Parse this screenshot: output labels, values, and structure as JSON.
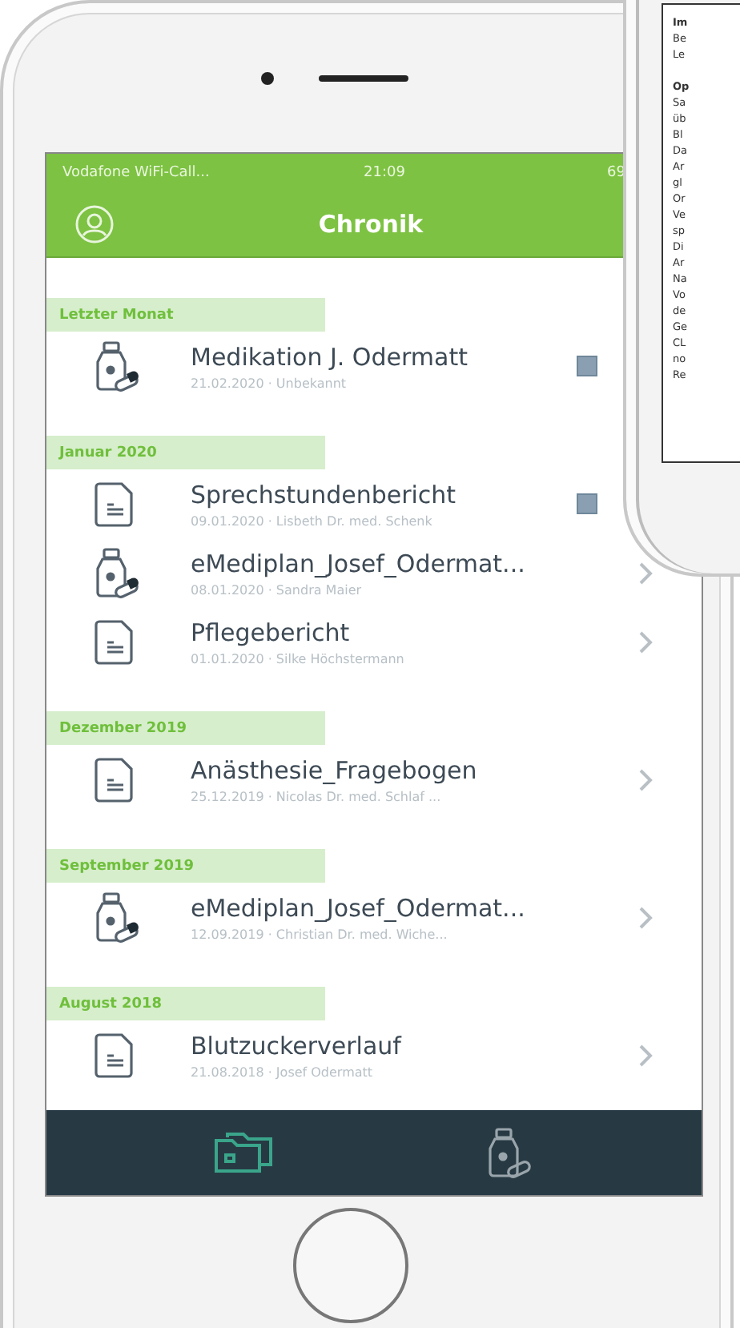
{
  "status_bar": {
    "carrier": "Vodafone WiFi-Call...",
    "time": "21:09",
    "battery": "69"
  },
  "header": {
    "title": "Chronik"
  },
  "sections": [
    {
      "label": "Letzter Monat",
      "items": [
        {
          "kind": "medication",
          "title": "Medikation J. Odermatt",
          "subtitle": "21.02.2020 · Unbekannt",
          "has_badge": true
        }
      ]
    },
    {
      "label": "Januar 2020",
      "items": [
        {
          "kind": "document",
          "title": "Sprechstundenbericht",
          "subtitle": "09.01.2020 · Lisbeth Dr. med. Schenk",
          "has_badge": true
        },
        {
          "kind": "medication",
          "title": "eMediplan_Josef_Odermat...",
          "subtitle": "08.01.2020 · Sandra Maier",
          "has_badge": false
        },
        {
          "kind": "document",
          "title": "Pflegebericht",
          "subtitle": "01.01.2020 · Silke Höchstermann",
          "has_badge": false
        }
      ]
    },
    {
      "label": "Dezember 2019",
      "items": [
        {
          "kind": "document",
          "title": "Anästhesie_Fragebogen",
          "subtitle": "25.12.2019 · Nicolas Dr. med. Schlaf ...",
          "has_badge": false
        }
      ]
    },
    {
      "label": "September 2019",
      "items": [
        {
          "kind": "medication",
          "title": "eMediplan_Josef_Odermat...",
          "subtitle": "12.09.2019 · Christian Dr. med. Wiche...",
          "has_badge": false
        }
      ]
    },
    {
      "label": "August 2018",
      "items": [
        {
          "kind": "document",
          "title": "Blutzuckerverlauf",
          "subtitle": "21.08.2018 · Josef Odermatt",
          "has_badge": false
        }
      ]
    }
  ],
  "tab_bar": [
    {
      "kind": "folder",
      "selected": true
    },
    {
      "kind": "medication",
      "selected": false
    }
  ],
  "background_document": {
    "fragments": [
      "Im",
      "Be",
      "Le",
      "Op",
      "Sa",
      "üb",
      "Bl",
      "Da",
      "Ar",
      "gl",
      "Or",
      "Ve",
      "sp",
      "Di",
      "Ar",
      "Na",
      "Vo",
      "de",
      "Ge",
      "CL",
      "no",
      "Re"
    ]
  }
}
